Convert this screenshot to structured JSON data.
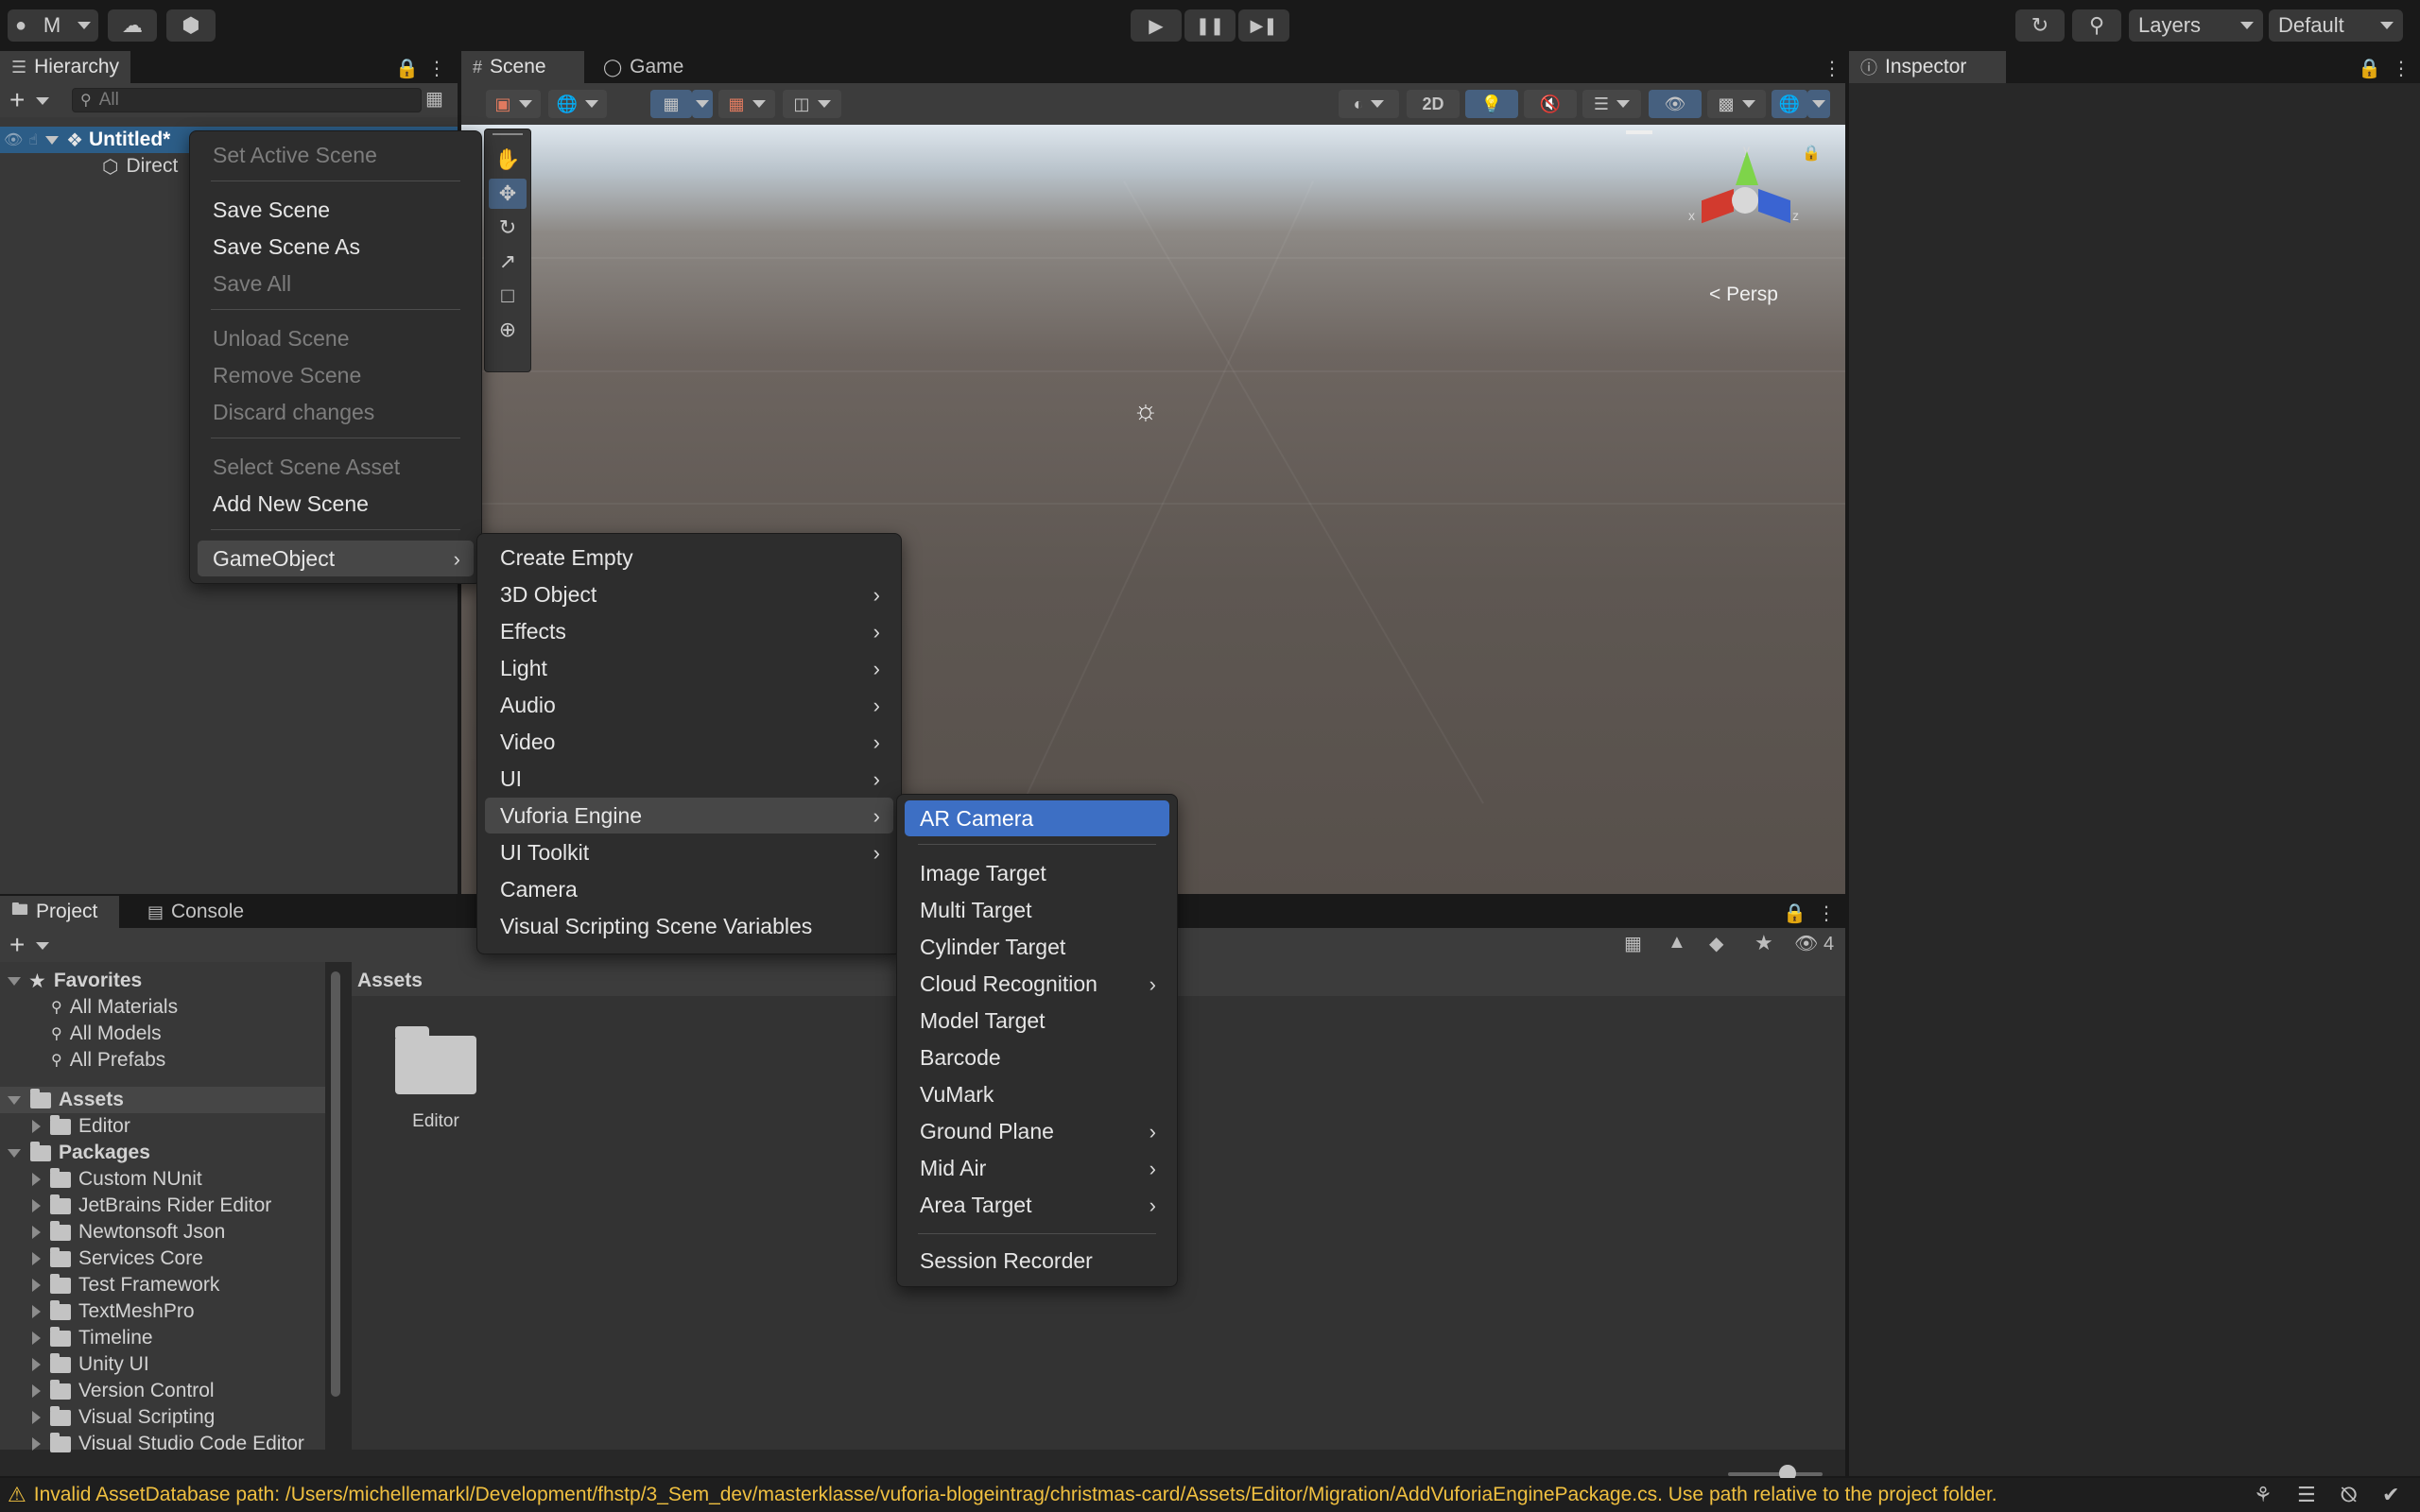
{
  "toolbar": {
    "account_label": "M",
    "layers_label": "Layers",
    "layout_label": "Default"
  },
  "hierarchy": {
    "tab_label": "Hierarchy",
    "search_placeholder": "All",
    "scene_name": "Untitled*",
    "child_name": "Direct"
  },
  "scene": {
    "tab_scene": "Scene",
    "tab_game": "Game",
    "btn_2d": "2D",
    "persp_label": "Persp",
    "gizmo_x": "x",
    "gizmo_y": "y",
    "gizmo_z": "z"
  },
  "inspector": {
    "tab_label": "Inspector"
  },
  "scene_menu": {
    "items": [
      {
        "label": "Set Active Scene",
        "enabled": false
      },
      {
        "label": "Save Scene",
        "enabled": true
      },
      {
        "label": "Save Scene As",
        "enabled": true
      },
      {
        "label": "Save All",
        "enabled": false
      },
      {
        "label": "Unload Scene",
        "enabled": false
      },
      {
        "label": "Remove Scene",
        "enabled": false
      },
      {
        "label": "Discard changes",
        "enabled": false
      },
      {
        "label": "Select Scene Asset",
        "enabled": false
      },
      {
        "label": "Add New Scene",
        "enabled": true
      },
      {
        "label": "GameObject",
        "enabled": true
      }
    ]
  },
  "gameobject_menu": {
    "items": [
      {
        "label": "Create Empty"
      },
      {
        "label": "3D Object"
      },
      {
        "label": "Effects"
      },
      {
        "label": "Light"
      },
      {
        "label": "Audio"
      },
      {
        "label": "Video"
      },
      {
        "label": "UI"
      },
      {
        "label": "Vuforia Engine"
      },
      {
        "label": "UI Toolkit"
      },
      {
        "label": "Camera"
      },
      {
        "label": "Visual Scripting Scene Variables"
      }
    ]
  },
  "vuforia_menu": {
    "items": [
      {
        "label": "AR Camera"
      },
      {
        "label": "Image Target"
      },
      {
        "label": "Multi Target"
      },
      {
        "label": "Cylinder Target"
      },
      {
        "label": "Cloud Recognition"
      },
      {
        "label": "Model Target"
      },
      {
        "label": "Barcode"
      },
      {
        "label": "VuMark"
      },
      {
        "label": "Ground Plane"
      },
      {
        "label": "Mid Air"
      },
      {
        "label": "Area Target"
      },
      {
        "label": "Session Recorder"
      }
    ]
  },
  "project": {
    "tab_project": "Project",
    "tab_console": "Console",
    "hidden_count": "4",
    "favorites_label": "Favorites",
    "favorites": [
      "All Materials",
      "All Models",
      "All Prefabs"
    ],
    "assets_label": "Assets",
    "assets_children": [
      "Editor"
    ],
    "packages_label": "Packages",
    "packages": [
      "Custom NUnit",
      "JetBrains Rider Editor",
      "Newtonsoft Json",
      "Services Core",
      "Test Framework",
      "TextMeshPro",
      "Timeline",
      "Unity UI",
      "Version Control",
      "Visual Scripting",
      "Visual Studio Code Editor"
    ],
    "breadcrumb": "Assets",
    "grid_items": [
      "Editor"
    ]
  },
  "status": {
    "message": "Invalid AssetDatabase path: /Users/michellemarkl/Development/fhstp/3_Sem_dev/masterklasse/vuforia-blogeintrag/christmas-card/Assets/Editor/Migration/AddVuforiaEnginePackage.cs. Use path relative to the project folder."
  }
}
